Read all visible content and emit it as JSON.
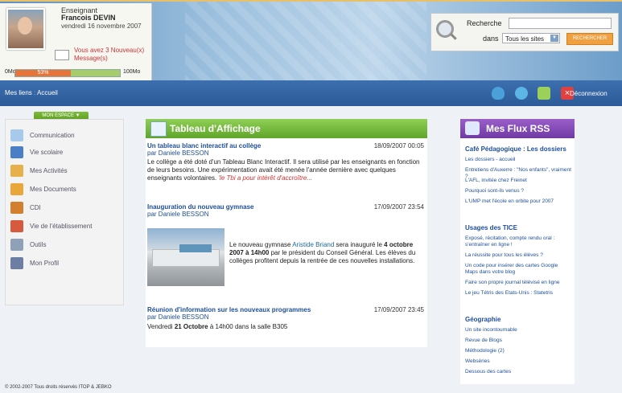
{
  "user": {
    "role": "Enseignant",
    "name": "Francois DEVIN",
    "date": "vendredi 16 novembre 2007",
    "messages": [
      "Vous avez 3 Nouveau(x)",
      "Message(s)"
    ],
    "quota_min": "0Mo",
    "quota_max": "100Mo",
    "quota_percent": 53,
    "quota_label": "53%"
  },
  "search": {
    "label": "Recherche",
    "dans": "dans",
    "scope": "Tous les sites",
    "button": "RECHERCHER"
  },
  "nav": {
    "breadcrumb_root": "Mes liens",
    "breadcrumb_sep": ":",
    "breadcrumb_page": "Accueil",
    "logout": "Déconnexion"
  },
  "sidebar": {
    "badge": "MON ESPACE ▼",
    "items": [
      {
        "label": "Communication",
        "color": "#a7c9ec"
      },
      {
        "label": "Vie scolaire",
        "color": "#4a7fc8"
      },
      {
        "label": "Mes Activités",
        "color": "#e7b04b"
      },
      {
        "label": "Mes Documents",
        "color": "#e9a63a"
      },
      {
        "label": "CDI",
        "color": "#d28030"
      },
      {
        "label": "Vie de l'établissement",
        "color": "#d85a3c"
      },
      {
        "label": "Outils",
        "color": "#8fa1b6"
      },
      {
        "label": "Mon Profil",
        "color": "#6c7ea4"
      }
    ]
  },
  "board": {
    "title": "Tableau d'Affichage",
    "articles": [
      {
        "title": "Un tableau blanc interactif au collège",
        "date": "18/09/2007 00:05",
        "author": "par Daniele BESSON",
        "body": "Le collège a été doté d'un Tableau Blanc Interactif. Il sera utilisé par les enseignants en fonction de leurs besoins. Une expérimentation avait été menée l'année dernière avec quelques enseignants volontaires.",
        "more": "'le Tbi a pour intérêt d'accroître..."
      },
      {
        "title": "Inauguration du nouveau gymnase",
        "date": "17/09/2007 23:54",
        "author": "par Daniele BESSON",
        "text_a": "Le nouveau gymnase ",
        "highlight": "Aristide Briand",
        "text_b": " sera inauguré le ",
        "bold": "4 octobre 2007 à 14h00",
        "text_c": " par le président du Conseil Général. Les élèves du collèges profitent depuis la rentrée de ces nouvelles installations."
      },
      {
        "title": "Réunion d'information sur les nouveaux programmes",
        "date": "17/09/2007 23:45",
        "author": "par Daniele BESSON",
        "text_a": "Vendredi ",
        "bold": "21 Octobre",
        "text_b": " à 14h00 dans la salle B305"
      }
    ]
  },
  "rss": {
    "title": "Mes Flux RSS",
    "sections": [
      {
        "title": "Café Pédagogique : Les dossiers",
        "links": [
          "Les dossiers - accueil",
          "Entretiens d'Auxerre : \"Nos enfants\", vraiment ?",
          "L'AFL, invitée chez Freinet",
          "Pourquoi sont-ils venus ?",
          "L'UMP met l'école en orbite pour 2007"
        ]
      },
      {
        "title": "Usages des TICE",
        "links": [
          "Exposé, récitation, compte rendu oral : s'entraîner en ligne !",
          "La réussite pour tous les élèves ?",
          "Un code pour insérer des cartes Google Maps dans votre blog",
          "Faire son propre journal télévisé en ligne",
          "Le jeu Tétris des Etats-Unis : Statetris"
        ]
      },
      {
        "title": "Géographie",
        "links": [
          "Un site incontournable",
          "Revue de Blogs",
          "Méthodologie (2)",
          "Webséries",
          "Dessous des cartes"
        ]
      }
    ]
  },
  "footer": "© 2002-2007 Tous droits réservés ITOP & JEBKO"
}
